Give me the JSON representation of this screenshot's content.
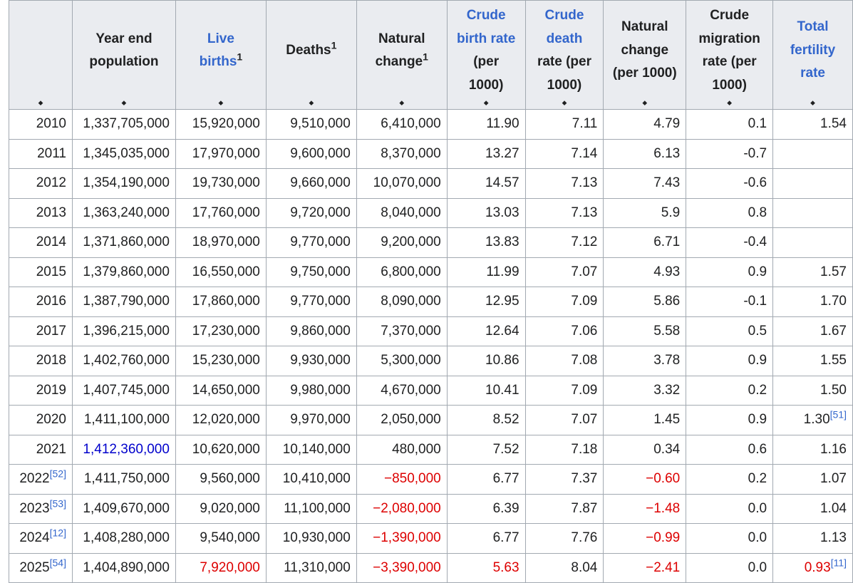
{
  "headers": [
    {
      "lines": [],
      "sup": "",
      "link": false
    },
    {
      "lines": [
        "Year end",
        "population"
      ],
      "sup": "",
      "link": false
    },
    {
      "lines": [
        "Live",
        "births"
      ],
      "sup": "1",
      "link": true,
      "link_part": "Live births"
    },
    {
      "lines": [
        "Deaths"
      ],
      "sup": "1",
      "link": false
    },
    {
      "lines": [
        "Natural",
        "change"
      ],
      "sup": "1",
      "link": false
    },
    {
      "lines": [
        "Crude",
        "birth rate",
        "(per",
        "1000)"
      ],
      "sup": "",
      "link": true,
      "link_lines": 2
    },
    {
      "lines": [
        "Crude",
        "death",
        "rate (per",
        "1000)"
      ],
      "sup": "",
      "link": true,
      "link_lines": 2
    },
    {
      "lines": [
        "Natural",
        "change",
        "(per 1000)"
      ],
      "sup": "",
      "link": false
    },
    {
      "lines": [
        "Crude",
        "migration",
        "rate (per",
        "1000)"
      ],
      "sup": "",
      "link": false
    },
    {
      "lines": [
        "Total",
        "fertility",
        "rate"
      ],
      "sup": "",
      "link": true,
      "link_lines": 3
    }
  ],
  "rows": [
    {
      "year": "2010",
      "ref": "",
      "pop": "1,337,705,000",
      "births": "15,920,000",
      "deaths": "9,510,000",
      "nat": "6,410,000",
      "cbr": "11.90",
      "cdr": "7.11",
      "ncr": "4.79",
      "mig": "0.1",
      "tfr": "1.54",
      "tfr_ref": ""
    },
    {
      "year": "2011",
      "ref": "",
      "pop": "1,345,035,000",
      "births": "17,970,000",
      "deaths": "9,600,000",
      "nat": "8,370,000",
      "cbr": "13.27",
      "cdr": "7.14",
      "ncr": "6.13",
      "mig": "-0.7",
      "tfr": "",
      "tfr_ref": ""
    },
    {
      "year": "2012",
      "ref": "",
      "pop": "1,354,190,000",
      "births": "19,730,000",
      "deaths": "9,660,000",
      "nat": "10,070,000",
      "cbr": "14.57",
      "cdr": "7.13",
      "ncr": "7.43",
      "mig": "-0.6",
      "tfr": "",
      "tfr_ref": ""
    },
    {
      "year": "2013",
      "ref": "",
      "pop": "1,363,240,000",
      "births": "17,760,000",
      "deaths": "9,720,000",
      "nat": "8,040,000",
      "cbr": "13.03",
      "cdr": "7.13",
      "ncr": "5.9",
      "mig": "0.8",
      "tfr": "",
      "tfr_ref": ""
    },
    {
      "year": "2014",
      "ref": "",
      "pop": "1,371,860,000",
      "births": "18,970,000",
      "deaths": "9,770,000",
      "nat": "9,200,000",
      "cbr": "13.83",
      "cdr": "7.12",
      "ncr": "6.71",
      "mig": "-0.4",
      "tfr": "",
      "tfr_ref": ""
    },
    {
      "year": "2015",
      "ref": "",
      "pop": "1,379,860,000",
      "births": "16,550,000",
      "deaths": "9,750,000",
      "nat": "6,800,000",
      "cbr": "11.99",
      "cdr": "7.07",
      "ncr": "4.93",
      "mig": "0.9",
      "tfr": "1.57",
      "tfr_ref": ""
    },
    {
      "year": "2016",
      "ref": "",
      "pop": "1,387,790,000",
      "births": "17,860,000",
      "deaths": "9,770,000",
      "nat": "8,090,000",
      "cbr": "12.95",
      "cdr": "7.09",
      "ncr": "5.86",
      "mig": "-0.1",
      "tfr": "1.70",
      "tfr_ref": ""
    },
    {
      "year": "2017",
      "ref": "",
      "pop": "1,396,215,000",
      "births": "17,230,000",
      "deaths": "9,860,000",
      "nat": "7,370,000",
      "cbr": "12.64",
      "cdr": "7.06",
      "ncr": "5.58",
      "mig": "0.5",
      "tfr": "1.67",
      "tfr_ref": ""
    },
    {
      "year": "2018",
      "ref": "",
      "pop": "1,402,760,000",
      "births": "15,230,000",
      "deaths": "9,930,000",
      "nat": "5,300,000",
      "cbr": "10.86",
      "cdr": "7.08",
      "ncr": "3.78",
      "mig": "0.9",
      "tfr": "1.55",
      "tfr_ref": ""
    },
    {
      "year": "2019",
      "ref": "",
      "pop": "1,407,745,000",
      "births": "14,650,000",
      "deaths": "9,980,000",
      "nat": "4,670,000",
      "cbr": "10.41",
      "cdr": "7.09",
      "ncr": "3.32",
      "mig": "0.2",
      "tfr": "1.50",
      "tfr_ref": ""
    },
    {
      "year": "2020",
      "ref": "",
      "pop": "1,411,100,000",
      "births": "12,020,000",
      "deaths": "9,970,000",
      "nat": "2,050,000",
      "cbr": "8.52",
      "cdr": "7.07",
      "ncr": "1.45",
      "mig": "0.9",
      "tfr": "1.30",
      "tfr_ref": "[51]"
    },
    {
      "year": "2021",
      "ref": "",
      "pop": "1,412,360,000",
      "pop_style": "blue",
      "births": "10,620,000",
      "deaths": "10,140,000",
      "nat": "480,000",
      "cbr": "7.52",
      "cdr": "7.18",
      "ncr": "0.34",
      "mig": "0.6",
      "tfr": "1.16",
      "tfr_ref": ""
    },
    {
      "year": "2022",
      "ref": "[52]",
      "pop": "1,411,750,000",
      "births": "9,560,000",
      "deaths": "10,410,000",
      "nat": "−850,000",
      "nat_style": "neg",
      "cbr": "6.77",
      "cdr": "7.37",
      "ncr": "−0.60",
      "ncr_style": "neg",
      "mig": "0.2",
      "tfr": "1.07",
      "tfr_ref": ""
    },
    {
      "year": "2023",
      "ref": "[53]",
      "pop": "1,409,670,000",
      "births": "9,020,000",
      "deaths": "11,100,000",
      "nat": "−2,080,000",
      "nat_style": "neg",
      "cbr": "6.39",
      "cdr": "7.87",
      "ncr": "−1.48",
      "ncr_style": "neg",
      "mig": "0.0",
      "tfr": "1.04",
      "tfr_ref": ""
    },
    {
      "year": "2024",
      "ref": "[12]",
      "pop": "1,408,280,000",
      "births": "9,540,000",
      "deaths": "10,930,000",
      "nat": "−1,390,000",
      "nat_style": "neg",
      "cbr": "6.77",
      "cdr": "7.76",
      "ncr": "−0.99",
      "ncr_style": "neg",
      "mig": "0.0",
      "tfr": "1.13",
      "tfr_ref": ""
    },
    {
      "year": "2025",
      "ref": "[54]",
      "pop": "1,404,890,000",
      "births": "7,920,000",
      "births_style": "red",
      "deaths": "11,310,000",
      "nat": "−3,390,000",
      "nat_style": "neg",
      "cbr": "5.63",
      "cbr_style": "red",
      "cdr": "8.04",
      "ncr": "−2.41",
      "ncr_style": "neg",
      "mig": "0.0",
      "tfr": "0.93",
      "tfr_style": "red",
      "tfr_ref": "[11]"
    }
  ],
  "sort_glyph": "⬥"
}
